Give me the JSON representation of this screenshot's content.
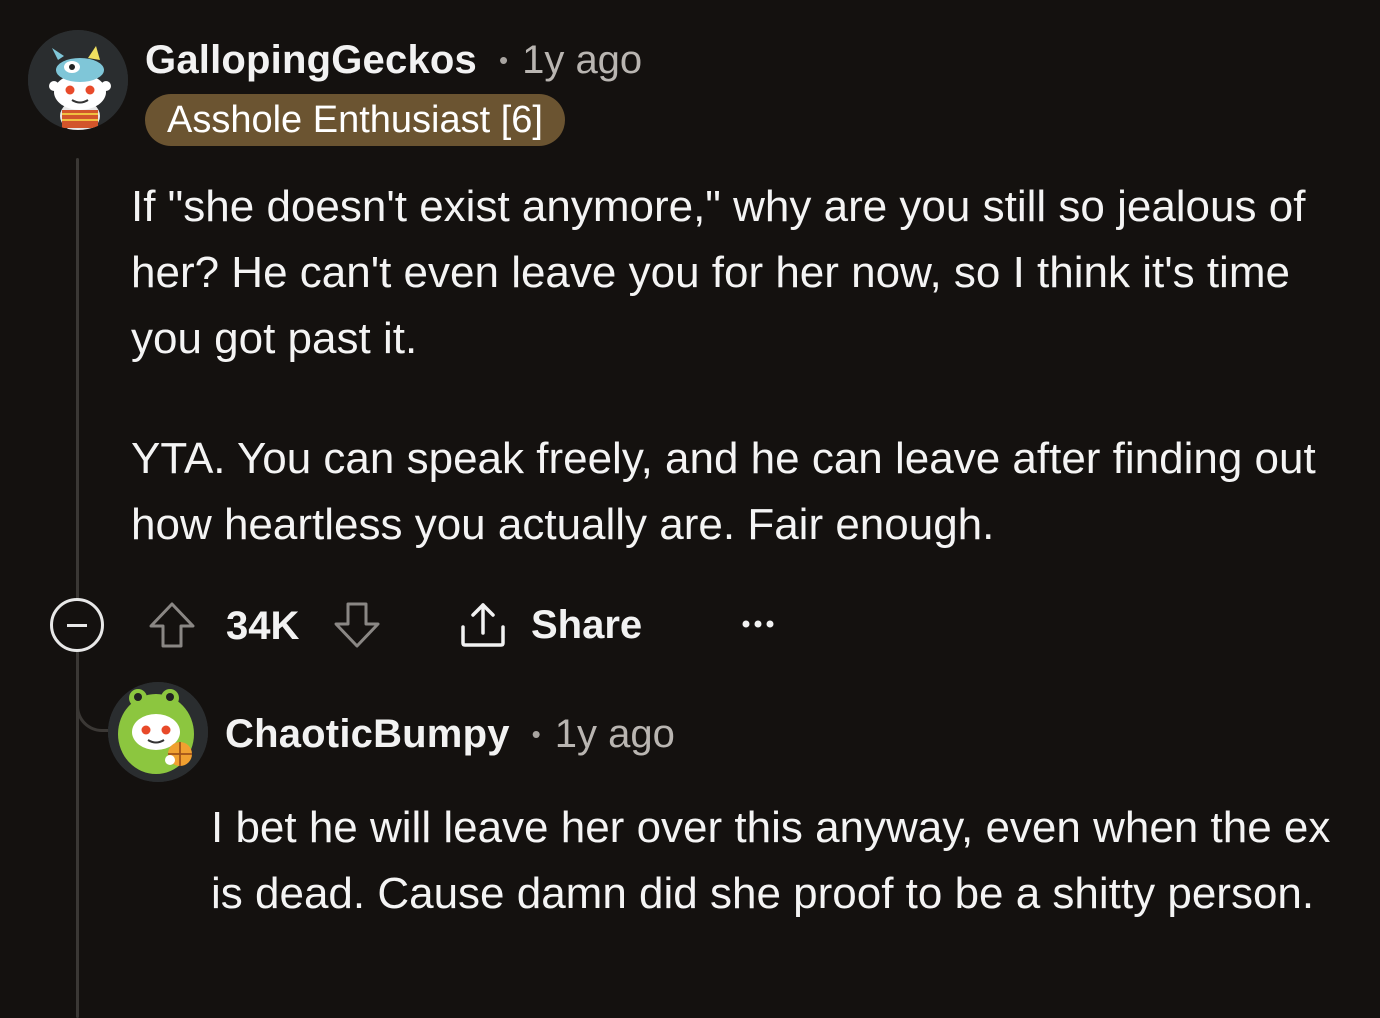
{
  "comment": {
    "username": "GallopingGeckos",
    "separator": "•",
    "time": "1y ago",
    "flair": "Asshole Enthusiast [6]",
    "body": [
      "If \"she doesn't exist anymore,\" why are you still so jealous of her? He can't even leave you for her now, so I think it's time you got past it.",
      "YTA. You can speak freely, and he can leave after finding out how heartless you actually are. Fair enough."
    ],
    "actions": {
      "score": "34K",
      "share_label": "Share"
    }
  },
  "reply": {
    "username": "ChaoticBumpy",
    "separator": "•",
    "time": "1y ago",
    "body": "I bet he will leave her over this anyway, even when the ex is dead. Cause damn did she proof to be a shitty person."
  },
  "colors": {
    "background": "#14110f",
    "flair_bg": "#6b5431",
    "thread_line": "#3b3835",
    "text": "#f4f4f4",
    "muted": "#b9b5b1"
  }
}
